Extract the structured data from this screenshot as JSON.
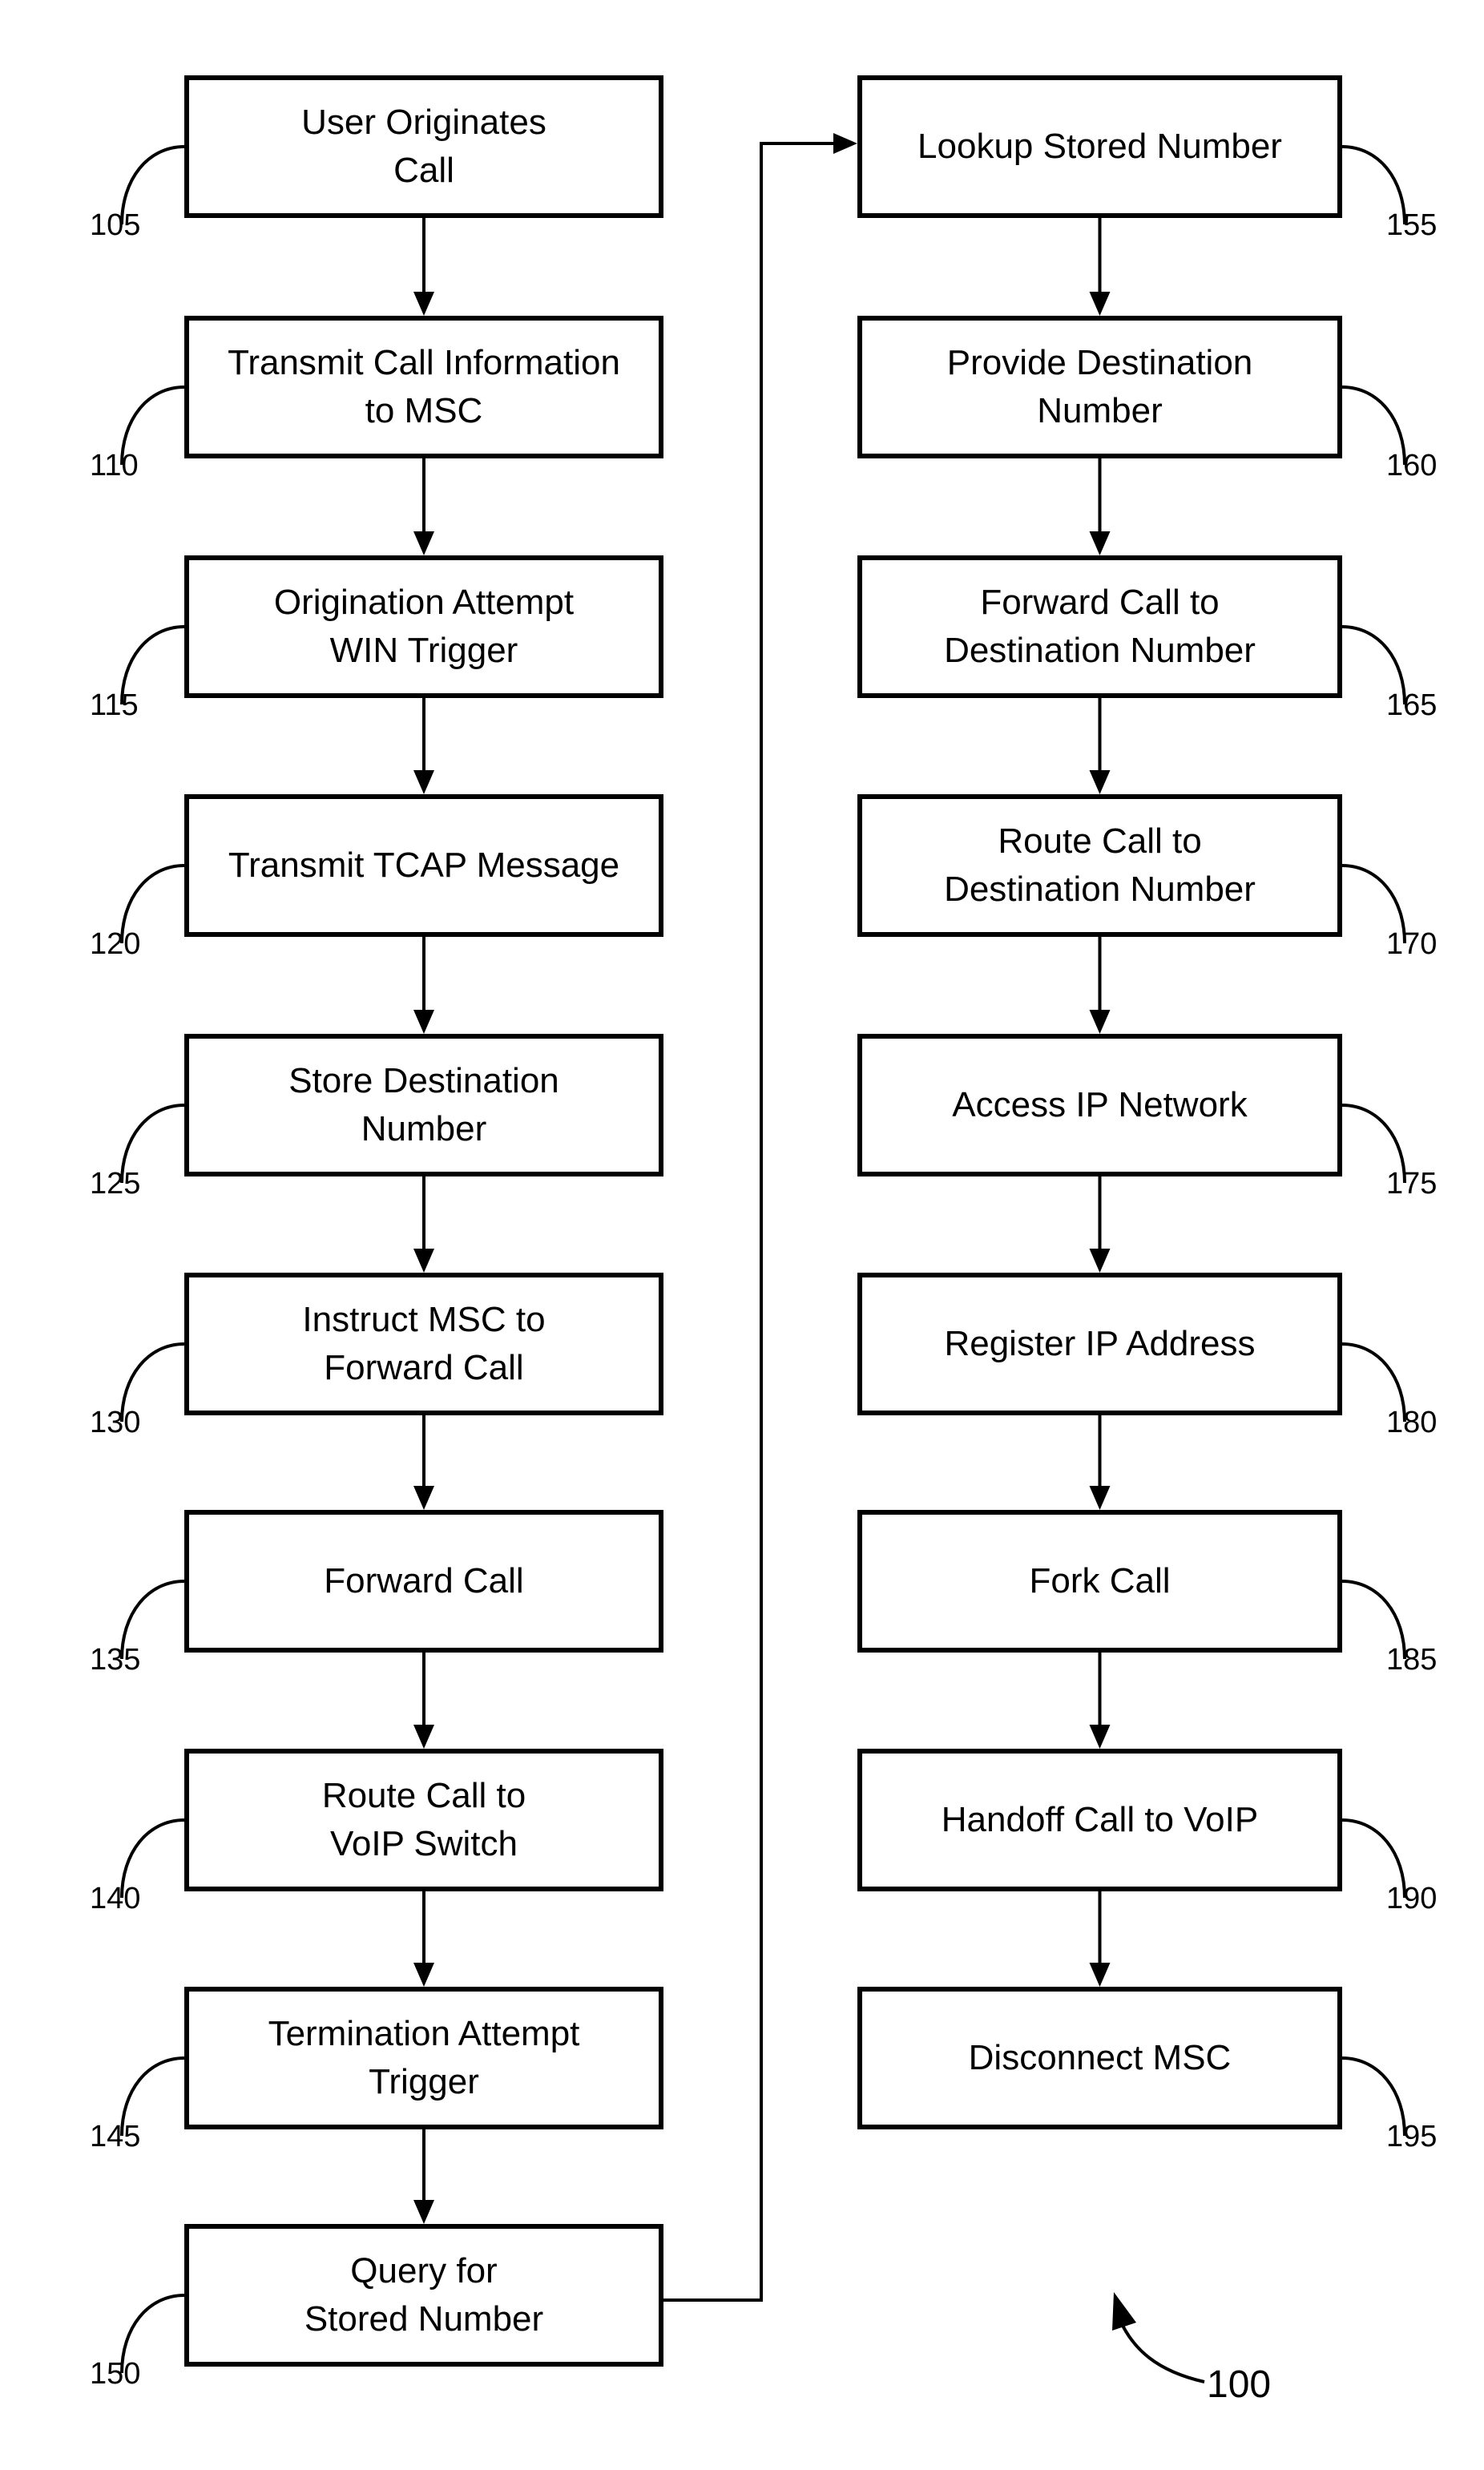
{
  "figure_ref": "100",
  "steps": [
    {
      "ref": "105",
      "label": "User Originates\nCall"
    },
    {
      "ref": "110",
      "label": "Transmit Call Information\nto MSC"
    },
    {
      "ref": "115",
      "label": "Origination Attempt\nWIN Trigger"
    },
    {
      "ref": "120",
      "label": "Transmit TCAP Message"
    },
    {
      "ref": "125",
      "label": "Store Destination\nNumber"
    },
    {
      "ref": "130",
      "label": "Instruct MSC to\nForward Call"
    },
    {
      "ref": "135",
      "label": "Forward Call"
    },
    {
      "ref": "140",
      "label": "Route Call to\nVoIP Switch"
    },
    {
      "ref": "145",
      "label": "Termination Attempt\nTrigger"
    },
    {
      "ref": "150",
      "label": "Query for\nStored Number"
    },
    {
      "ref": "155",
      "label": "Lookup Stored Number"
    },
    {
      "ref": "160",
      "label": "Provide Destination\nNumber"
    },
    {
      "ref": "165",
      "label": "Forward Call to\nDestination Number"
    },
    {
      "ref": "170",
      "label": "Route Call to\nDestination Number"
    },
    {
      "ref": "175",
      "label": "Access IP Network"
    },
    {
      "ref": "180",
      "label": "Register IP Address"
    },
    {
      "ref": "185",
      "label": "Fork Call"
    },
    {
      "ref": "190",
      "label": "Handoff Call to VoIP"
    },
    {
      "ref": "195",
      "label": "Disconnect MSC"
    }
  ]
}
